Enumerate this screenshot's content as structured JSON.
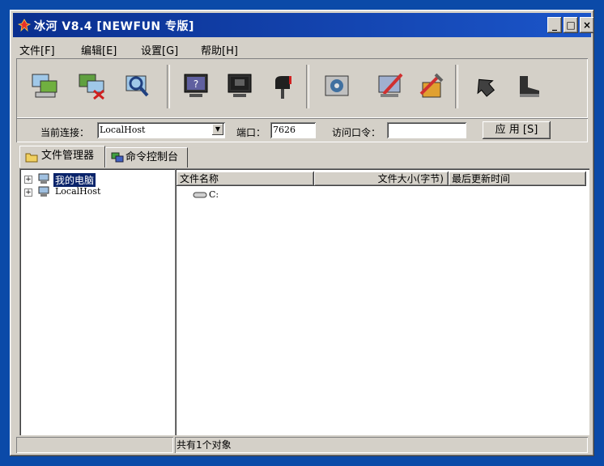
{
  "window": {
    "title": "冰河 V8.4 [NEWFUN 专版]"
  },
  "controls": {
    "minimize": "_",
    "maximize": "□",
    "close": "×"
  },
  "menu": [
    "文件[F]",
    "编辑[E]",
    "设置[G]",
    "帮助[H]"
  ],
  "toolbar": {
    "icons": [
      "add-host-icon",
      "delete-host-icon",
      "search-host-icon",
      "screen-capture-icon",
      "screen-control-icon",
      "mailbox-icon",
      "disk-icon",
      "edit-icon",
      "tools-icon",
      "arrow-icon",
      "boot-icon"
    ]
  },
  "connection": {
    "current_label": "当前连接：",
    "current_value": "LocalHost",
    "port_label": "端口：",
    "port_value": "7626",
    "password_label": "访问口令：",
    "password_value": "",
    "apply_label": "应 用 [S]"
  },
  "tabs": [
    "文件管理器",
    "命令控制台"
  ],
  "tree": [
    {
      "label": "我的电脑",
      "selected": true
    },
    {
      "label": "LocalHost",
      "selected": false
    }
  ],
  "columns": [
    "文件名称",
    "文件大小(字节)",
    "最后更新时间"
  ],
  "files": [
    {
      "name": "C:"
    }
  ],
  "status": {
    "left": "",
    "middle": "共有1个对象"
  }
}
